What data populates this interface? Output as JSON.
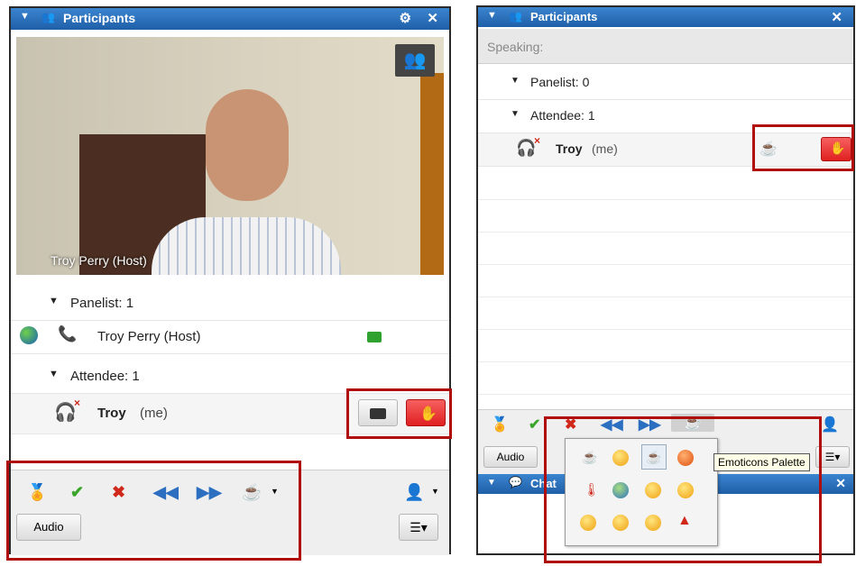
{
  "left_panel": {
    "title": "Participants",
    "video_caption": "Troy Perry (Host)",
    "panelist_header": "Panelist: 1",
    "panelist_name": "Troy Perry (Host)",
    "attendee_header": "Attendee: 1",
    "attendee_name": "Troy",
    "attendee_suffix": "(me)",
    "audio_label": "Audio"
  },
  "right_panel": {
    "title": "Participants",
    "speaking_label": "Speaking:",
    "panelist_header": "Panelist: 0",
    "attendee_header": "Attendee: 1",
    "attendee_name": "Troy",
    "attendee_suffix": "(me)",
    "audio_label": "Audio",
    "chat_title": "Chat",
    "tooltip": "Emoticons Palette"
  },
  "colors": {
    "titlebar": "#2a6fbd",
    "highlight_box": "#b00d0d",
    "green_check": "#3aa52a",
    "red_x": "#d0281a",
    "blue_arrows": "#2c6fc1"
  }
}
